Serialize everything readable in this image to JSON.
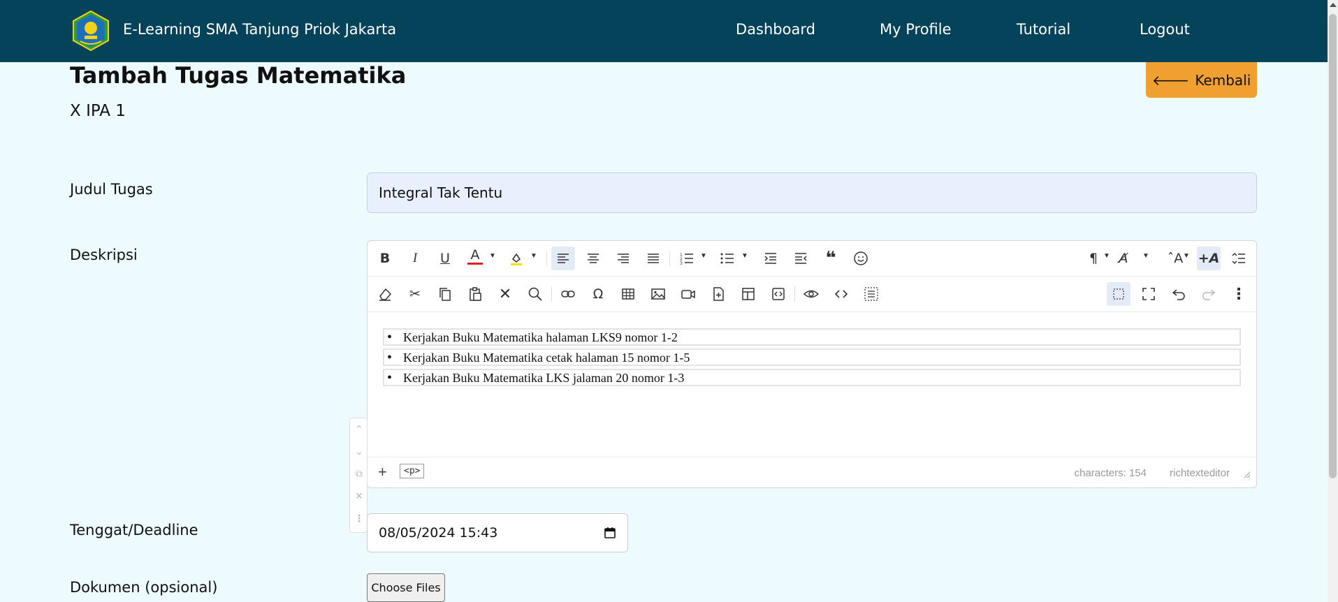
{
  "navbar": {
    "brand": "E-Learning SMA Tanjung Priok Jakarta",
    "links": [
      "Dashboard",
      "My Profile",
      "Tutorial",
      "Logout"
    ]
  },
  "header": {
    "title": "Tambah Tugas Matematika",
    "class_name": "X IPA 1",
    "back_label": "Kembali"
  },
  "form": {
    "title_label": "Judul Tugas",
    "title_value": "Integral Tak Tentu",
    "desc_label": "Deskripsi",
    "deadline_label": "Tenggat/Deadline",
    "deadline_value": "08/05/2024 15:43",
    "doc_label": "Dokumen (opsional)",
    "file_button": "Choose Files"
  },
  "editor": {
    "items": [
      "Kerjakan Buku Matematika halaman LKS9 nomor 1-2",
      "Kerjakan Buku Matematika cetak halaman 15 nomor 1-5",
      "Kerjakan Buku Matematika LKS jalaman 20 nomor 1-3"
    ],
    "tag": "<p>",
    "char_count": "characters: 154",
    "editor_name": "richtexteditor"
  },
  "colors": {
    "navbar": "#05435a",
    "background": "#eefbfe",
    "accent": "#f0a030"
  }
}
